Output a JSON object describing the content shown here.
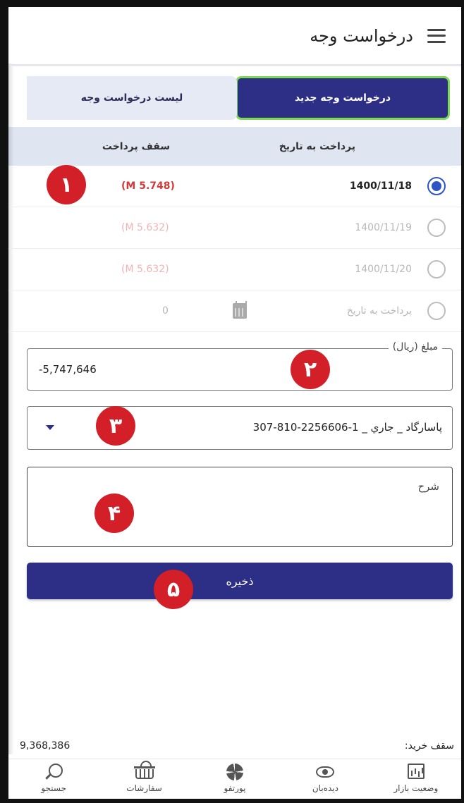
{
  "header": {
    "title": "درخواست وجه",
    "menu_icon": "hamburger-menu-icon"
  },
  "tabs": [
    {
      "label": "درخواست وجه جدید",
      "active": true
    },
    {
      "label": "لیست درخواست وجه",
      "active": false
    }
  ],
  "table": {
    "col_date": "پرداخت به تاریخ",
    "col_limit": "سقف پرداخت",
    "rows": [
      {
        "date": "1400/11/18",
        "amount": "(5.748 M)",
        "selected": true
      },
      {
        "date": "1400/11/19",
        "amount": "(5.632 M)",
        "selected": false
      },
      {
        "date": "1400/11/20",
        "amount": "(5.632 M)",
        "selected": false
      },
      {
        "date": "پرداخت به تاریخ",
        "amount": "0",
        "selected": false
      }
    ]
  },
  "form": {
    "amount_label": "مبلغ (ریال)",
    "amount_value": "-5,747,646",
    "account_value": "پاسارگاد _ جاري _ 1-2256606-810-307",
    "description_label": "شرح",
    "save_label": "ذخیره"
  },
  "badges": [
    "۱",
    "۲",
    "۳",
    "۴",
    "۵"
  ],
  "limit": {
    "label": "سقف خرید:",
    "value": "9,368,386"
  },
  "bottom_nav": [
    {
      "label": "وضعیت بازار",
      "icon": "market-status-icon"
    },
    {
      "label": "دیده‌بان",
      "icon": "eye-icon"
    },
    {
      "label": "پورتفو",
      "icon": "pie-chart-icon"
    },
    {
      "label": "سفارشات",
      "icon": "basket-icon"
    },
    {
      "label": "جستجو",
      "icon": "search-icon"
    }
  ],
  "colors": {
    "primary": "#2d2f86",
    "active_border": "#7ed957",
    "badge": "#d31f27",
    "amount_red": "#d23a3a",
    "radio": "#2e55c6"
  }
}
